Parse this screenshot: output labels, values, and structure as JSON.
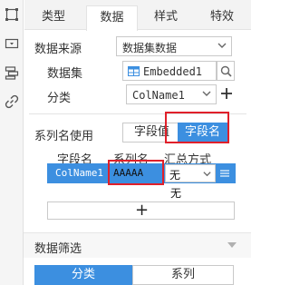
{
  "tabs": [
    "类型",
    "数据",
    "样式",
    "特效"
  ],
  "datasource": {
    "label": "数据来源",
    "value": "数据集数据"
  },
  "dataset": {
    "label": "数据集",
    "value": "Embedded1"
  },
  "category": {
    "label": "分类",
    "value": "ColName1"
  },
  "series_name_use": {
    "label": "系列名使用",
    "options": [
      "字段值",
      "字段名"
    ],
    "selected": "字段名"
  },
  "table": {
    "headers": [
      "字段名",
      "系列名",
      "汇总方式"
    ],
    "rows": [
      {
        "field": "ColName1",
        "series": "AAAAA",
        "agg": "无"
      }
    ],
    "dropdown_hint": "无"
  },
  "add_label": "+",
  "filter": {
    "title": "数据筛选",
    "tabs": [
      "分类",
      "系列"
    ],
    "active": "分类"
  },
  "colors": {
    "accent": "#3c8fe0",
    "highlight": "#e0202a"
  }
}
